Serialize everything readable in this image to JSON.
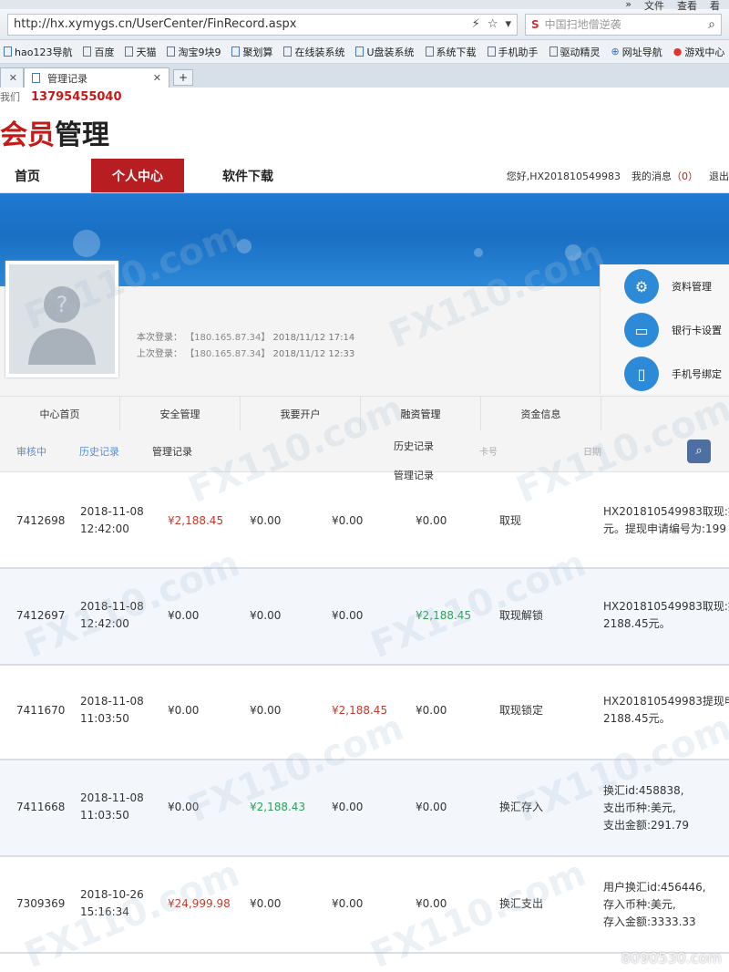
{
  "topstrip": {
    "chevron": "»",
    "file": "文件",
    "view": "查看",
    "more": "看"
  },
  "browser": {
    "url": "http://hx.xymygs.cn/UserCenter/FinRecord.aspx",
    "search_placeholder": "中国扫地僧逆袭",
    "favorites": [
      "hao123导航",
      "百度",
      "天猫",
      "淘宝9块9",
      "聚划算",
      "在线装系统",
      "U盘装系统",
      "系统下载",
      "手机助手",
      "驱动精灵",
      "网址导航",
      "游戏中心"
    ],
    "tab_active": "管理记录",
    "new_tab": "+"
  },
  "site": {
    "contact_label": "我们",
    "phone": "13795455040",
    "brand_red": "会员",
    "brand_black": "管理",
    "nav": {
      "home": "首页",
      "center": "个人中心",
      "download": "软件下载"
    },
    "greeting": "您好,HX201810549983",
    "messages_label": "我的消息",
    "messages_count": "（0）",
    "logout": "退出"
  },
  "profile": {
    "current_login_label": "本次登录：",
    "current_login_ip": "【180.165.87.34】",
    "current_login_time": "2018/11/12 17:14",
    "last_login_label": "上次登录：",
    "last_login_ip": "【180.165.87.34】",
    "last_login_time": "2018/11/12 12:33",
    "side": [
      "资料管理",
      "银行卡设置",
      "手机号绑定"
    ]
  },
  "subnav": [
    "中心首页",
    "安全管理",
    "我要开户",
    "融资管理",
    "资金信息"
  ],
  "dropdown": [
    "历史记录",
    "管理记录"
  ],
  "filter": {
    "tabs": [
      "审核中",
      "历史记录",
      "管理记录"
    ],
    "card_placeholder": "卡号",
    "date_placeholder": "日期"
  },
  "records": [
    {
      "id": "7412698",
      "date": "2018-11-08",
      "time": "12:42:00",
      "a1": "¥2,188.45",
      "a2": "¥0.00",
      "a3": "¥0.00",
      "a4": "¥0.00",
      "type": "取现",
      "note1": "HX201810549983取现:提",
      "note2": "元。提现申请编号为:199",
      "note3": ""
    },
    {
      "id": "7412697",
      "date": "2018-11-08",
      "time": "12:42:00",
      "a1": "¥0.00",
      "a2": "¥0.00",
      "a3": "¥0.00",
      "a4": "¥2,188.45",
      "type": "取现解锁",
      "note1": "HX201810549983取现:提",
      "note2": "2188.45元。",
      "note3": ""
    },
    {
      "id": "7411670",
      "date": "2018-11-08",
      "time": "11:03:50",
      "a1": "¥0.00",
      "a2": "¥0.00",
      "a3": "¥2,188.45",
      "a4": "¥0.00",
      "type": "取现锁定",
      "note1": "HX201810549983提现申",
      "note2": "2188.45元。",
      "note3": ""
    },
    {
      "id": "7411668",
      "date": "2018-11-08",
      "time": "11:03:50",
      "a1": "¥0.00",
      "a2": "¥2,188.43",
      "a3": "¥0.00",
      "a4": "¥0.00",
      "type": "换汇存入",
      "note1": "换汇id:458838,",
      "note2": "支出币种:美元,",
      "note3": "支出金额:291.79"
    },
    {
      "id": "7309369",
      "date": "2018-10-26",
      "time": "15:16:34",
      "a1": "¥24,999.98",
      "a2": "¥0.00",
      "a3": "¥0.00",
      "a4": "¥0.00",
      "type": "换汇支出",
      "note1": "用户换汇id:456446,",
      "note2": "存入币种:美元,",
      "note3": "存入金额:3333.33"
    }
  ],
  "watermark": "FX110.com",
  "footer_watermark": "8090530.com",
  "colors": {
    "brand_red": "#b81d22",
    "banner_blue": "#1f7ad1",
    "debit_red": "#c0392b",
    "credit_green": "#2e9e5a"
  }
}
